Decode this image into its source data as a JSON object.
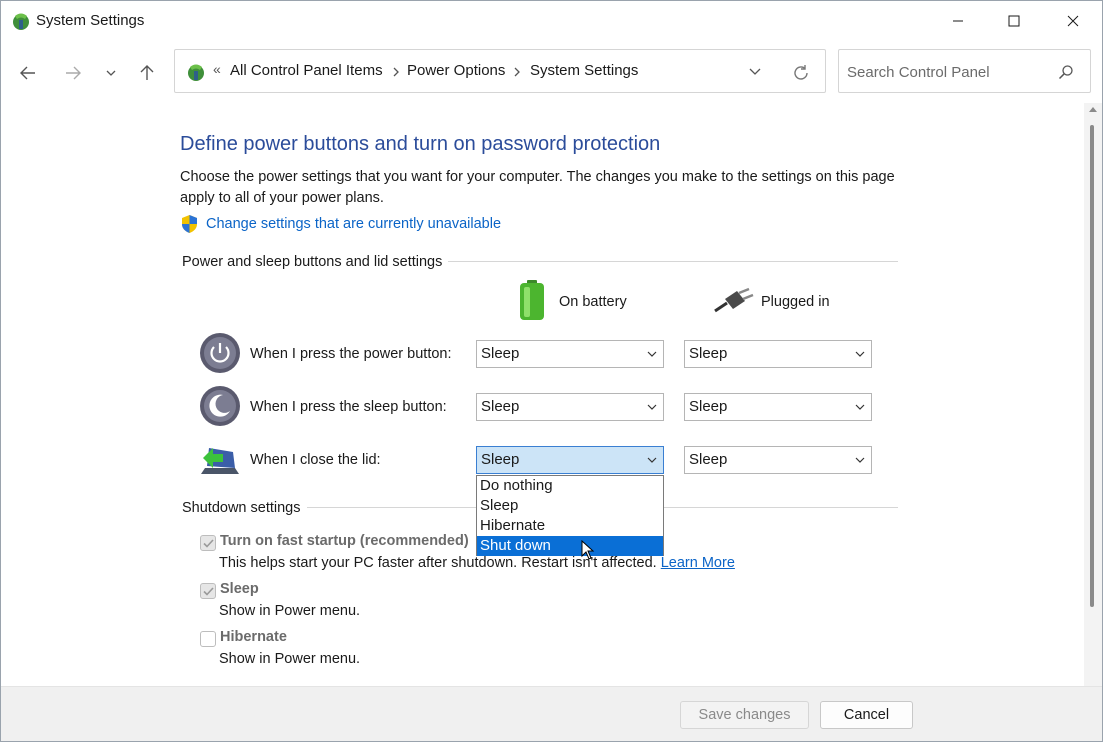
{
  "window": {
    "title": "System Settings"
  },
  "nav": {
    "breadcrumbs": [
      "All Control Panel Items",
      "Power Options",
      "System Settings"
    ],
    "breadcrumb_prefix": "«",
    "search_placeholder": "Search Control Panel"
  },
  "main": {
    "title": "Define power buttons and turn on password protection",
    "description": "Choose the power settings that you want for your computer. The changes you make to the settings on this page apply to all of your power plans.",
    "change_link": "Change settings that are currently unavailable",
    "group_power": "Power and sleep buttons and lid settings",
    "col_battery": "On battery",
    "col_plugged": "Plugged in",
    "rows": [
      {
        "label": "When I press the power button:",
        "battery": "Sleep",
        "plugged": "Sleep"
      },
      {
        "label": "When I press the sleep button:",
        "battery": "Sleep",
        "plugged": "Sleep"
      },
      {
        "label": "When I close the lid:",
        "battery": "Sleep",
        "plugged": "Sleep"
      }
    ],
    "dropdown_options": [
      "Do nothing",
      "Sleep",
      "Hibernate",
      "Shut down"
    ],
    "dropdown_highlighted": "Shut down",
    "group_shutdown": "Shutdown settings",
    "shutdown": [
      {
        "label": "Turn on fast startup (recommended)",
        "desc": "This helps start your PC faster after shutdown. Restart isn't affected.",
        "link": "Learn More",
        "checked": true
      },
      {
        "label": "Sleep",
        "desc": "Show in Power menu.",
        "checked": true
      },
      {
        "label": "Hibernate",
        "desc": "Show in Power menu.",
        "checked": false
      }
    ]
  },
  "footer": {
    "save_label": "Save changes",
    "cancel_label": "Cancel"
  },
  "colors": {
    "title_blue": "#2b4c9a",
    "link_blue": "#0b64c7",
    "highlight": "#0a6fd6",
    "active_select": "#cce4f7"
  }
}
